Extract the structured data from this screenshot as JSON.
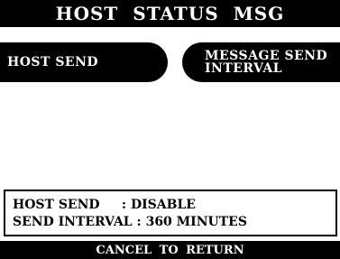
{
  "title": "HOST STATUS MSG",
  "menu": {
    "left_label": "HOST SEND",
    "right_line1": "MESSAGE SEND",
    "right_line2": "INTERVAL"
  },
  "status": {
    "row1_label": "HOST SEND     ",
    "row1_sep": ": ",
    "row1_value": "DISABLE",
    "row2_label": "SEND INTERVAL ",
    "row2_sep": ": ",
    "row2_value": "360 MINUTES"
  },
  "footer": "CANCEL TO RETURN"
}
